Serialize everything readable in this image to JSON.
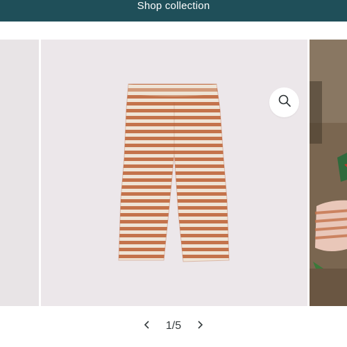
{
  "header": {
    "cta_label": "Shop collection"
  },
  "gallery": {
    "main_alt": "Striped leggings",
    "zoom_icon": "search-icon"
  },
  "pager": {
    "current": 1,
    "total": 5,
    "counter_text": "1/5",
    "prev_icon": "chevron-left-icon",
    "next_icon": "chevron-right-icon"
  },
  "colors": {
    "header_bg": "#1f4f59",
    "stripe_rust": "#c4734b",
    "stripe_cream": "#efe4d6",
    "slide_bg": "#ece7ea"
  }
}
